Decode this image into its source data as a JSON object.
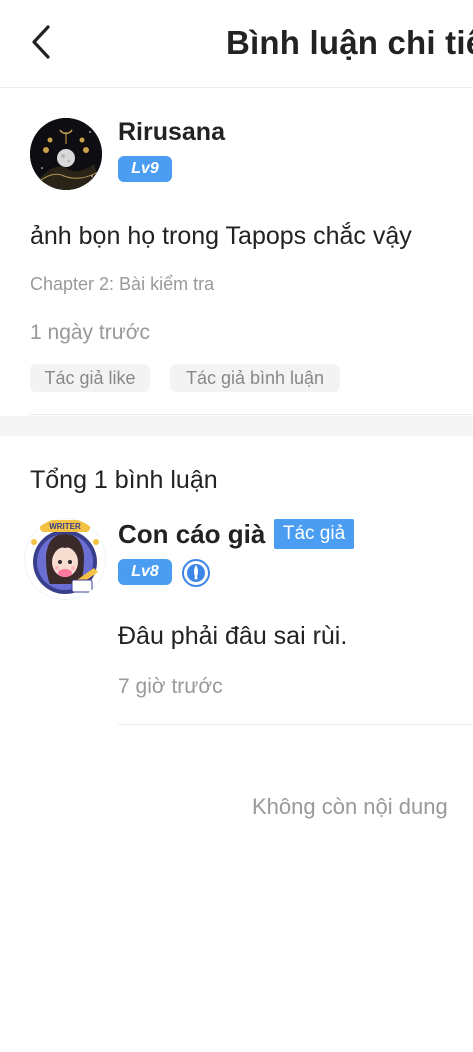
{
  "header": {
    "title": "Bình luận chi tiết"
  },
  "main_comment": {
    "username": "Rirusana",
    "level": "Lv9",
    "text": "ảnh bọn họ trong Tapops chắc vậy",
    "chapter": "Chapter 2: Bài kiểm tra",
    "time": "1 ngày trước",
    "tags": [
      "Tác giả like",
      "Tác giả bình luận"
    ]
  },
  "replies_section": {
    "total_label": "Tổng 1 bình luận",
    "replies": [
      {
        "username": "Con cáo già",
        "author_tag": "Tác giả",
        "level": "Lv8",
        "avatar_banner": "WRITER",
        "text": "Đâu phải đâu sai rùi.",
        "time": "7 giờ trước"
      }
    ]
  },
  "footer": {
    "end_label": "Không còn nội dung"
  },
  "colors": {
    "accent": "#4a9df0",
    "muted_text": "#999999",
    "tag_bg": "#f3f3f3"
  }
}
